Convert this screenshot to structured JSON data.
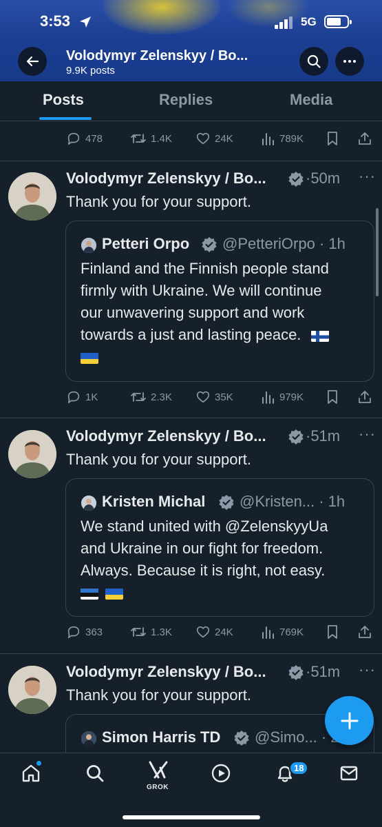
{
  "status_bar": {
    "time": "3:53",
    "network": "5G"
  },
  "header": {
    "title": "Volodymyr Zelenskyy / Bo...",
    "post_count": "9.9K posts",
    "icons": [
      "back-arrow-icon",
      "search-icon",
      "more-icon"
    ]
  },
  "tabs": [
    {
      "label": "Posts",
      "active": true
    },
    {
      "label": "Replies",
      "active": false
    },
    {
      "label": "Media",
      "active": false
    }
  ],
  "top_actions": {
    "replies": "478",
    "reposts": "1.4K",
    "likes": "24K",
    "views": "789K"
  },
  "posts": [
    {
      "author": "Volodymyr Zelenskyy / Bo...",
      "time": "·50m",
      "text": "Thank you for your support.",
      "quote": {
        "name": "Petteri Orpo",
        "handle": "@PetteriOrpo · 1h",
        "lines": [
          "Finland and the Finnish people stand",
          "firmly with Ukraine. We will continue",
          "our unwavering support and work",
          "towards a just and lasting peace."
        ],
        "flags": [
          "finland",
          "ukraine"
        ]
      },
      "actions": {
        "replies": "1K",
        "reposts": "2.3K",
        "likes": "35K",
        "views": "979K"
      }
    },
    {
      "author": "Volodymyr Zelenskyy / Bo...",
      "time": "·51m",
      "text": "Thank you for your support.",
      "quote": {
        "name": "Kristen Michal",
        "handle": "@Kristen... · 1h",
        "lines": [
          "We stand united with @ZelenskyyUa",
          "and Ukraine in our fight for freedom.",
          "Always. Because it is right, not easy."
        ],
        "flags": [
          "estonia",
          "ukraine"
        ]
      },
      "actions": {
        "replies": "363",
        "reposts": "1.3K",
        "likes": "24K",
        "views": "769K"
      }
    },
    {
      "author": "Volodymyr Zelenskyy / Bo...",
      "time": "·51m",
      "text": "Thank you for your support.",
      "quote": {
        "name": "Simon Harris TD",
        "handle": "@Simo... · 2..."
      }
    }
  ],
  "bottom_nav": {
    "items": [
      "home-icon",
      "search-icon",
      "grok-icon",
      "video-icon",
      "notifications-icon",
      "messages-icon"
    ],
    "grok_label": "GROK",
    "notification_count": "18"
  },
  "colors": {
    "accent": "#1d9bf0",
    "background": "#15202b",
    "muted": "#8b98a5",
    "border": "#38444d"
  }
}
